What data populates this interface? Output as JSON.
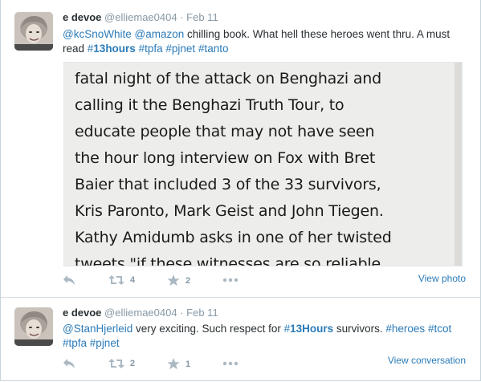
{
  "tweets": [
    {
      "fullname": "e devoe",
      "username": "@elliemae0404",
      "separator": "·",
      "time": "Feb 11",
      "text": {
        "mention1": "@kcSnoWhite",
        "mention2": "@amazon",
        "plain1": " chilling book. What hell these heroes went thru. A must read ",
        "hashtag1_hash": "#",
        "hashtag1_tag": "13hours",
        "hashtag2": "#tpfa",
        "hashtag3": "#pjnet",
        "hashtag4": "#tanto"
      },
      "media_lines": [
        "fatal night of the attack on Benghazi and",
        "calling it the Benghazi Truth Tour, to",
        "educate people that may not have seen",
        "the hour long interview on Fox with Bret",
        "Baier that included 3 of the 33 survivors,",
        "Kris Paronto, Mark Geist and John Tiegen.",
        "Kathy Amidumb asks in one of her twisted",
        "tweets \"if these witnesses are so reliable"
      ],
      "retweet_count": "4",
      "favorite_count": "2",
      "expand_label": "View photo"
    },
    {
      "fullname": "e devoe",
      "username": "@elliemae0404",
      "separator": "·",
      "time": "Feb 11",
      "text": {
        "mention1": "@StanHjerleid",
        "plain1": " very exciting. Such respect for ",
        "hashtag1_hash": "#",
        "hashtag1_tag": "13Hours",
        "plain2": " survivors. ",
        "hashtag2": "#heroes",
        "hashtag3": "#tcot",
        "hashtag4": "#tpfa",
        "hashtag5": "#pjnet"
      },
      "retweet_count": "2",
      "favorite_count": "1",
      "expand_label": "View conversation"
    }
  ],
  "colors": {
    "link": "#2b7bb9",
    "muted": "#8899a6",
    "text": "#292f33"
  },
  "icons": [
    "reply-icon",
    "retweet-icon",
    "favorite-star-icon",
    "more-dots-icon"
  ]
}
